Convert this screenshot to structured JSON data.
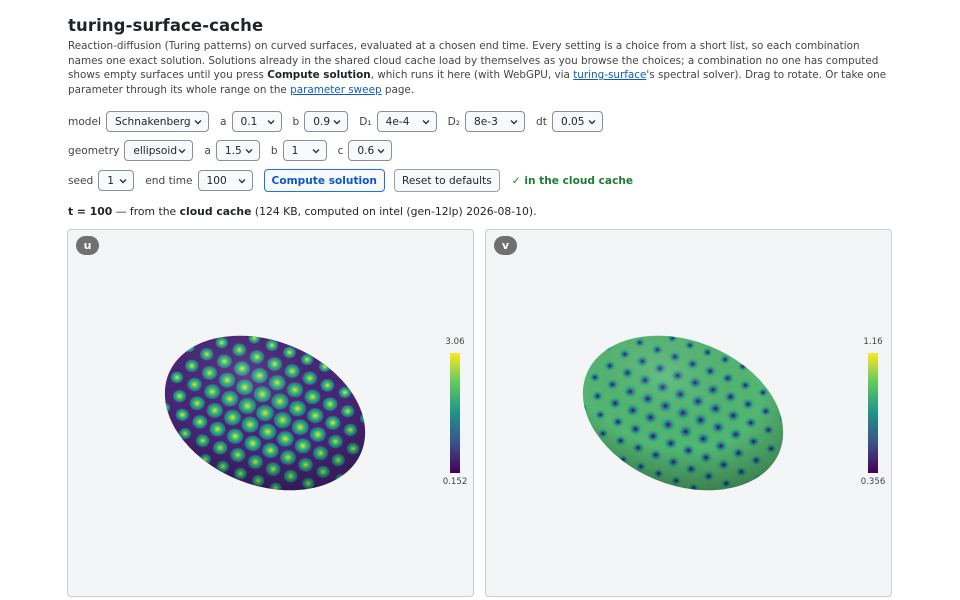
{
  "title": "turing-surface-cache",
  "description": {
    "part1": "Reaction-diffusion (Turing patterns) on curved surfaces, evaluated at a chosen end time. Every setting is a choice from a short list, so each combination names one exact solution. Solutions already in the shared cloud cache load by themselves as you browse the choices; a combination no one has computed shows empty surfaces until you press ",
    "bold": "Compute solution",
    "part2": ", which runs it here (with WebGPU, via ",
    "link1": "turing-surface",
    "part3": "'s spectral solver). Drag to rotate. Or take one parameter through its whole range on the ",
    "link2": "parameter sweep",
    "part4": " page."
  },
  "controls": {
    "model_label": "model",
    "model": "Schnakenberg",
    "a_label": "a",
    "a": "0.1",
    "b_label": "b",
    "b": "0.9",
    "d1_label": "D₁",
    "d1": "4e-4",
    "d2_label": "D₂",
    "d2": "8e-3",
    "dt_label": "dt",
    "dt": "0.05",
    "geometry_label": "geometry",
    "geometry": "ellipsoid",
    "ga_label": "a",
    "ga": "1.5",
    "gb_label": "b",
    "gb": "1",
    "gc_label": "c",
    "gc": "0.6",
    "seed_label": "seed",
    "seed": "1",
    "end_time_label": "end time",
    "end_time": "100",
    "compute_label": "Compute solution",
    "reset_label": "Reset to defaults",
    "cache_status": "✓ in the cloud cache"
  },
  "status": {
    "t_label": "t = 100",
    "mid": " — from the ",
    "source": "cloud cache",
    "detail": " (124 KB, computed on intel (gen-12lp) 2026-08-10)."
  },
  "panels": [
    {
      "label": "u",
      "max": "3.06",
      "min": "0.152",
      "pattern": "spots",
      "colormap": "viridis"
    },
    {
      "label": "v",
      "max": "1.16",
      "min": "0.356",
      "pattern": "inverse-spots",
      "colormap": "viridis"
    }
  ],
  "colors": {
    "accent": "#1a73e8",
    "ok": "#1e7b34",
    "link": "#0a5cc2"
  }
}
